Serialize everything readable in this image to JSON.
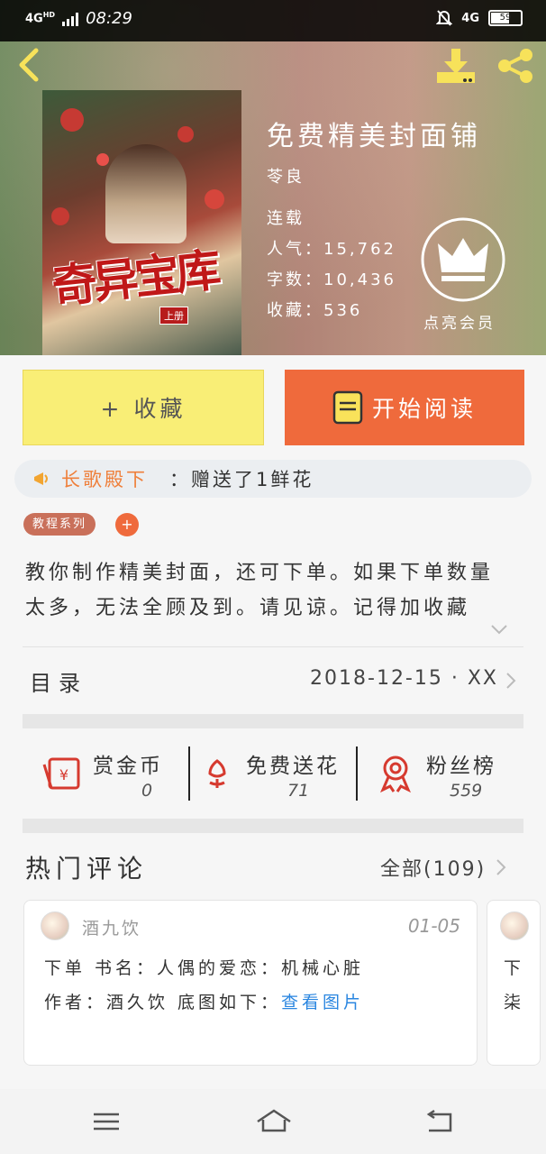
{
  "status_bar": {
    "network": "4G",
    "network_sub": "HD",
    "time": "08:29",
    "right_network": "4G",
    "battery": "59"
  },
  "header": {
    "back_icon": "chevron-left-icon",
    "download_icon": "download-icon",
    "share_icon": "share-icon"
  },
  "book": {
    "cover_title": "奇异宝库",
    "cover_sub": "上册",
    "title": "免费精美封面铺",
    "author": "苓良",
    "status": "连载",
    "popularity": "人气：15,762",
    "words": "字数：10,436",
    "favorites": "收藏：536"
  },
  "vip": {
    "label": "点亮会员",
    "icon": "crown-icon"
  },
  "actions": {
    "favorite": "+ 收藏",
    "read": "开始阅读"
  },
  "gift": {
    "user": "长歌殿下",
    "text": "：赠送了1鲜花"
  },
  "tags": {
    "series": "教程系列",
    "add": "+"
  },
  "description": {
    "line1": "教你制作精美封面，还可下单。如果下单数量",
    "line2": "太多，无法全顾及到。请见谅。记得加收藏"
  },
  "toc": {
    "label": "目录",
    "date": "2018-12-15 · XX"
  },
  "stats": [
    {
      "label": "赏金币",
      "value": "0",
      "icon": "red-envelope-icon"
    },
    {
      "label": "免费送花",
      "value": "71",
      "icon": "flower-icon"
    },
    {
      "label": "粉丝榜",
      "value": "559",
      "icon": "medal-icon"
    }
  ],
  "comments": {
    "title": "热门评论",
    "all": "全部(109)",
    "items": [
      {
        "user": "酒九饮",
        "date": "01-05",
        "line1": "下单  书名：人偶的爱恋：机械心脏",
        "line2": "作者：酒久饮  底图如下：",
        "link": "查看图片"
      },
      {
        "line1": "下",
        "line2": "柒"
      }
    ]
  }
}
